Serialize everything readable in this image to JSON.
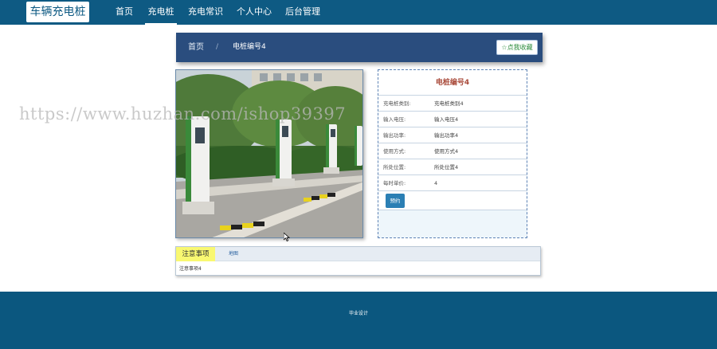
{
  "nav": {
    "logo": "车辆充电桩",
    "items": [
      {
        "label": "首页",
        "active": false
      },
      {
        "label": "充电桩",
        "active": true
      },
      {
        "label": "充电常识",
        "active": false
      },
      {
        "label": "个人中心",
        "active": false
      },
      {
        "label": "后台管理",
        "active": false
      }
    ]
  },
  "breadcrumb": {
    "home": "首页",
    "separator": "/",
    "current": "电桩编号4"
  },
  "favorite_button": {
    "icon": "star-outline-icon",
    "label": "☆点我收藏"
  },
  "detail": {
    "title": "电桩编号4",
    "fields": [
      {
        "label": "充电桩类别:",
        "value": "充电桩类别4"
      },
      {
        "label": "输入电压:",
        "value": "输入电压4"
      },
      {
        "label": "输出功率:",
        "value": "输出功率4"
      },
      {
        "label": "使用方式:",
        "value": "使用方式4"
      },
      {
        "label": "所处位置:",
        "value": "所处位置4"
      },
      {
        "label": "每时单价:",
        "value": "4"
      }
    ],
    "book_button": "预约"
  },
  "tabs": {
    "items": [
      "注意事项",
      "地图"
    ],
    "content": "注意事项4"
  },
  "footer": {
    "text": "毕业设计"
  },
  "watermark": "https://www.huzhan.com/ishop39397",
  "colors": {
    "nav_bg": "#0e5a83",
    "breadcrumb_bg": "#2a4d7e",
    "title_red": "#a94a3a",
    "button_blue": "#2b7fb4",
    "tab_yellow": "#f9f871",
    "footer_bg": "#0b577f"
  }
}
